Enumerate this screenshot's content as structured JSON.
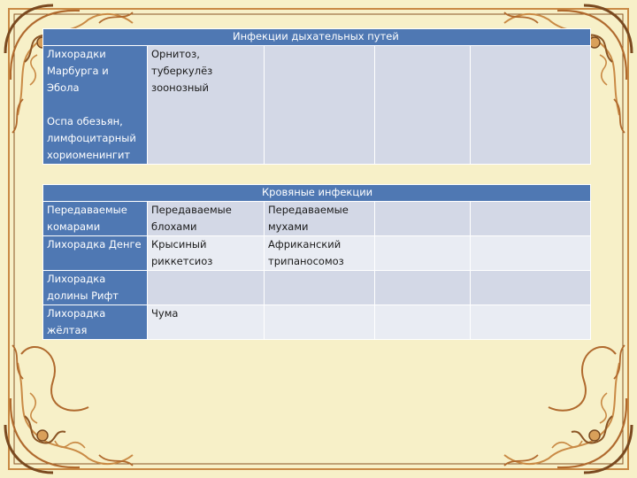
{
  "table1": {
    "header": "Инфекции дыхательных путей",
    "rows": [
      {
        "c1": [
          "Лихорадки",
          "Марбурга и",
          "Эбола",
          "",
          "Оспа обезьян,",
          "лимфоцитарный",
          "хориоменингит"
        ],
        "c2": [
          "Орнитоз,",
          "туберкулёз",
          "зоонозный"
        ],
        "c3": [],
        "c4": [],
        "c5": []
      }
    ]
  },
  "table2": {
    "header": "Кровяные инфекции",
    "rows": [
      {
        "c1": [
          "Передаваемые",
          "комарами"
        ],
        "c2": [
          "Передаваемые",
          "блохами"
        ],
        "c3": [
          "Передаваемые",
          "мухами"
        ],
        "c4": [],
        "c5": []
      },
      {
        "c1": [
          "Лихорадка Денге"
        ],
        "c2": [
          "Крысиный",
          "риккетсиоз"
        ],
        "c3": [
          "Африканский",
          "трипаносомоз"
        ],
        "c4": [],
        "c5": []
      },
      {
        "c1": [
          "Лихорадка",
          "долины Рифт"
        ],
        "c2": [],
        "c3": [],
        "c4": [],
        "c5": []
      },
      {
        "c1": [
          "Лихорадка",
          "жёлтая"
        ],
        "c2": [
          "Чума"
        ],
        "c3": [],
        "c4": [],
        "c5": []
      }
    ]
  },
  "colors": {
    "background": "#f7f0c8",
    "header": "#4f78b3",
    "cell": "#d3d8e6",
    "cell_alt": "#e9ecf3",
    "ornament": "#b06a2e"
  }
}
